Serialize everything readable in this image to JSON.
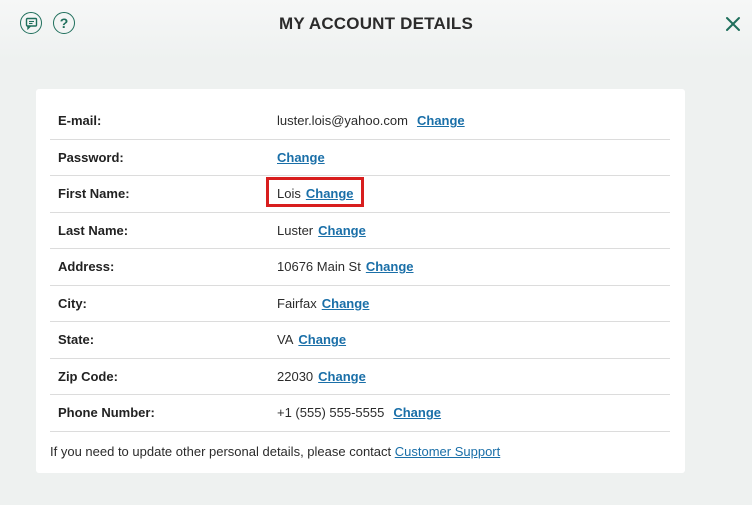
{
  "header": {
    "title": "MY ACCOUNT DETAILS",
    "help_glyph": "?",
    "icons": [
      "chat-icon",
      "help-icon",
      "close-icon"
    ]
  },
  "rows": [
    {
      "label": "E-mail:",
      "value": "luster.lois@yahoo.com",
      "action": "Change"
    },
    {
      "label": "Password:",
      "value": "",
      "action": "Change"
    },
    {
      "label": "First Name:",
      "value": "Lois",
      "action": "Change"
    },
    {
      "label": "Last Name:",
      "value": "Luster",
      "action": "Change"
    },
    {
      "label": "Address:",
      "value": "10676 Main St",
      "action": "Change"
    },
    {
      "label": "City:",
      "value": "Fairfax",
      "action": "Change"
    },
    {
      "label": "State:",
      "value": "VA",
      "action": "Change"
    },
    {
      "label": "Zip Code:",
      "value": "22030",
      "action": "Change"
    },
    {
      "label": "Phone Number:",
      "value": "+1 (555) 555-5555",
      "action": "Change"
    }
  ],
  "footer": {
    "note": "If you need to update other personal details, please contact ",
    "link": "Customer Support"
  },
  "colors": {
    "accent": "#1f6f5c",
    "link": "#1a6fa8",
    "highlight": "#d81e1e"
  }
}
